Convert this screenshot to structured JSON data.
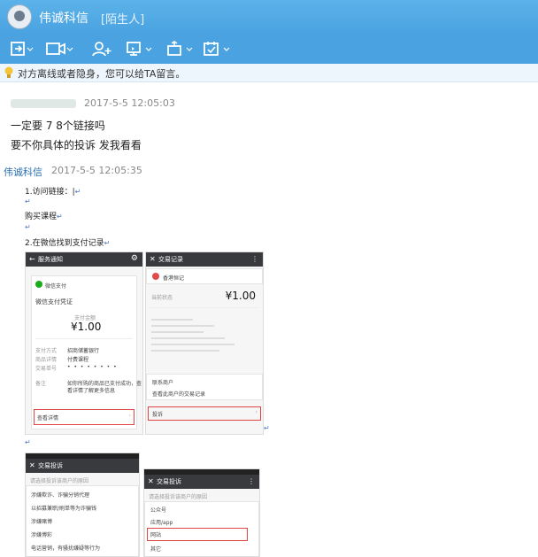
{
  "window": {
    "contact_name": "伟诚科信",
    "contact_tag": "[陌生人]"
  },
  "toolbar": {
    "icons": [
      "file-transfer-icon",
      "video-call-icon",
      "add-contact-icon",
      "screen-share-icon",
      "remote-assist-icon",
      "app-icon"
    ]
  },
  "notice": {
    "text": "对方离线或者隐身，您可以给TA留言。"
  },
  "messages": [
    {
      "timestamp": "2017-5-5 12:05:03",
      "lines": [
        "一定要 7 8个链接吗",
        "要不你具体的投诉 发我看看"
      ]
    },
    {
      "sender": "伟诚科信",
      "timestamp": "2017-5-5 12:05:35",
      "doc": {
        "step1": "1.访问链接：",
        "line_buy": "购买课程",
        "step2": "2.在微信找到支付记录",
        "return_mark": "↵"
      }
    }
  ],
  "phone1": {
    "title": "服务通知",
    "payment_brand": "微信支付",
    "voucher_title": "微信支付凭证",
    "amount_label": "支付金额",
    "amount": "¥1.00",
    "row1_label": "支付方式",
    "row1_value": "招商储蓄银行",
    "row2_label": "商品详情",
    "row2_value": "付费课程",
    "row3_label": "交易单号",
    "row4_label": "备注",
    "row4_value1": "如你所购的商品已支付成功，查",
    "row4_value2": "看详情了解更多信息",
    "details_link": "查看详情"
  },
  "phone2": {
    "title": "交易记录",
    "merchant": "香港恒记",
    "amount_label": "当前状态",
    "amount": "¥1.00",
    "link1": "联系商户",
    "link2": "查看此商户的交易记录",
    "complaint": "投诉"
  },
  "phone3": {
    "title": "交易投诉",
    "subtitle": "请选择投诉该商户的原因",
    "items": [
      "涉嫌欺诈、诈骗分销代理",
      "以招募兼职/刷单等为诈骗钱",
      "涉嫌赌博",
      "涉嫌博彩",
      "电话营销，有骚扰嫌疑等行为"
    ]
  },
  "phone4": {
    "title": "交易投诉",
    "subtitle": "请选择投诉该商户的原因",
    "items": [
      "公众号",
      "应用/app",
      "网站",
      "其它"
    ]
  }
}
